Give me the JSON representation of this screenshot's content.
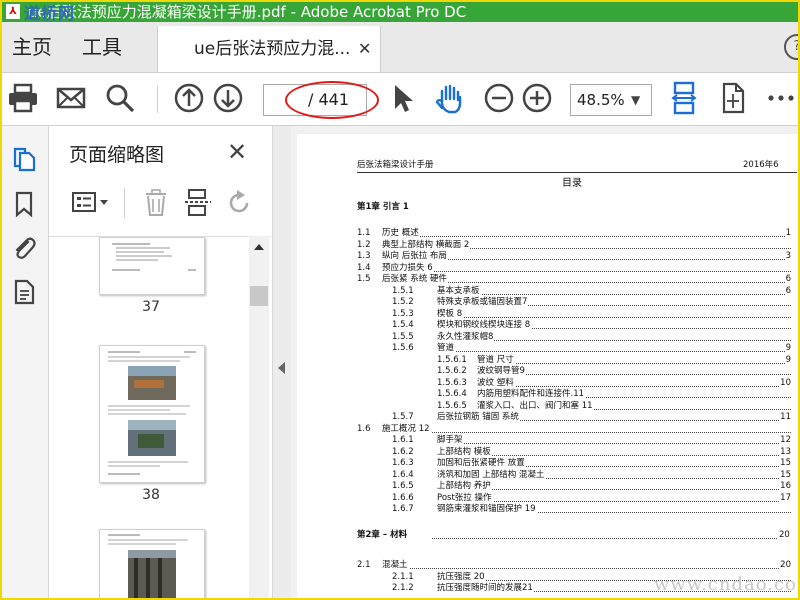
{
  "window": {
    "title": "ue后张法预应力混凝箱梁设计手册.pdf - Adobe Acrobat Pro DC",
    "watermark_logo": "道桥网"
  },
  "tabs": {
    "home": "主页",
    "tools": "工具",
    "document": "ue后张法预应力混...",
    "close": "✕",
    "help": "?"
  },
  "toolbar": {
    "page_current": "",
    "page_total": "/ 441",
    "zoom": "48.5%"
  },
  "thumbnails": {
    "title": "页面缩略图",
    "close": "✕",
    "pages": [
      "37",
      "38"
    ]
  },
  "document": {
    "header_left": "后张法箱梁设计手册",
    "header_right": "2016年6",
    "toc_title": "目录",
    "chapter1": "第1章 引言 1",
    "chapter2": "第2章 – 材料",
    "chapter2_page": "20",
    "entries": [
      {
        "num": "1.1",
        "title": "历史 概述",
        "page": "1",
        "level": 1
      },
      {
        "num": "1.2",
        "title": "典型上部结构 横截面 2",
        "page": "",
        "level": 1
      },
      {
        "num": "1.3",
        "title": "纵向 后张拉 布局",
        "page": "3",
        "level": 1
      },
      {
        "num": "1.4",
        "title": "预应力损失 6",
        "page": "",
        "level": 1
      },
      {
        "num": "1.5",
        "title": "后张紧 系统 硬件",
        "page": "6",
        "level": 1
      },
      {
        "num": "1.5.1",
        "title": "基本支承板",
        "page": "6",
        "level": 2
      },
      {
        "num": "1.5.2",
        "title": "特殊支承板或锚固装置7",
        "page": "",
        "level": 2
      },
      {
        "num": "1.5.3",
        "title": "楔板 8",
        "page": "",
        "level": 2
      },
      {
        "num": "1.5.4",
        "title": "楔块和钢绞线楔块连接 8",
        "page": "",
        "level": 2
      },
      {
        "num": "1.5.5",
        "title": "永久性灌浆帽8",
        "page": "",
        "level": 2
      },
      {
        "num": "1.5.6",
        "title": "管道",
        "page": "9",
        "level": 2
      },
      {
        "num": "1.5.6.1",
        "title": "管道 尺寸",
        "page": "9",
        "level": 3
      },
      {
        "num": "1.5.6.2",
        "title": "波纹钢导管9",
        "page": "",
        "level": 3
      },
      {
        "num": "1.5.6.3",
        "title": "波纹 塑料",
        "page": "10",
        "level": 3
      },
      {
        "num": "1.5.6.4",
        "title": "内筋用塑料配件和连接件.11",
        "page": "",
        "level": 3
      },
      {
        "num": "1.5.6.5",
        "title": "灌浆入口、出口、阀门和塞 11",
        "page": "",
        "level": 3
      },
      {
        "num": "1.5.7",
        "title": "后张拉钢筋 锚固 系统",
        "page": "11",
        "level": 2
      },
      {
        "num": "1.6",
        "title": "施工概况 12",
        "page": "",
        "level": 1
      },
      {
        "num": "1.6.1",
        "title": "脚手架",
        "page": "12",
        "level": 2
      },
      {
        "num": "1.6.2",
        "title": "上部结构 模板",
        "page": "13",
        "level": 2
      },
      {
        "num": "1.6.3",
        "title": "加固和后张紧硬件 放置",
        "page": "15",
        "level": 2
      },
      {
        "num": "1.6.4",
        "title": "浇筑和加固 上部结构 混凝土",
        "page": "15",
        "level": 2
      },
      {
        "num": "1.6.5",
        "title": "上部结构 养护",
        "page": "16",
        "level": 2
      },
      {
        "num": "1.6.6",
        "title": "Post张拉 操作",
        "page": "17",
        "level": 2
      },
      {
        "num": "1.6.7",
        "title": "钢筋束灌浆和锚固保护 19",
        "page": "",
        "level": 2
      }
    ],
    "entries2": [
      {
        "num": "2.1",
        "title": "混凝土",
        "page": "20",
        "level": 1
      },
      {
        "num": "2.1.1",
        "title": "抗压强度 20",
        "page": "",
        "level": 2
      },
      {
        "num": "2.1.2",
        "title": "抗压强度随时间的发展21",
        "page": "",
        "level": 2
      }
    ],
    "bottom_watermark": "www.cndao.com"
  }
}
